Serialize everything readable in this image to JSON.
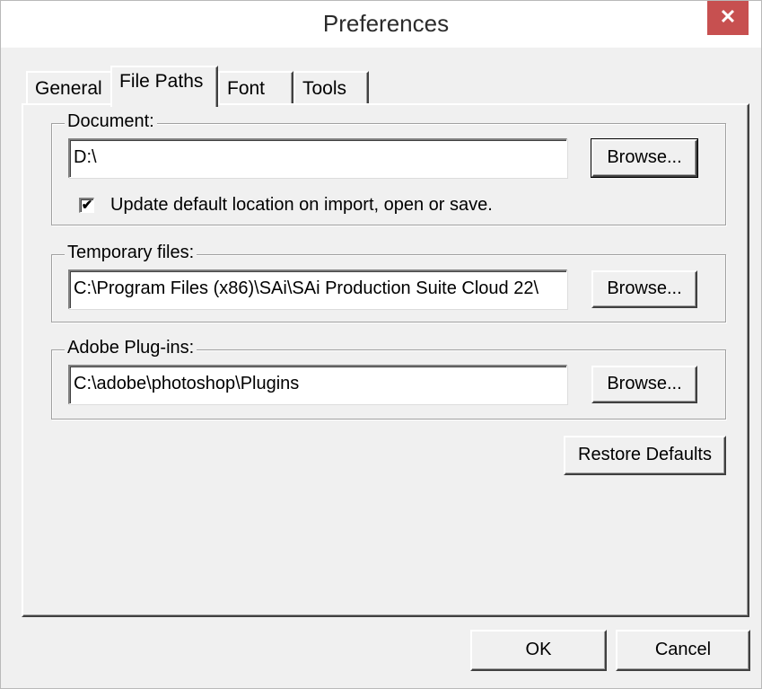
{
  "window": {
    "title": "Preferences",
    "close_glyph": "✕"
  },
  "tabs": [
    {
      "label": "General",
      "active": false
    },
    {
      "label": "File Paths",
      "active": true
    },
    {
      "label": "Font",
      "active": false
    },
    {
      "label": "Tools",
      "active": false
    }
  ],
  "document": {
    "label": "Document:",
    "value": "D:\\",
    "browse_label": "Browse...",
    "checkbox_checked": true,
    "checkbox_glyph": "✔",
    "checkbox_label": "Update default location on import, open or save."
  },
  "temporary": {
    "label": "Temporary files:",
    "value": "C:\\Program Files (x86)\\SAi\\SAi Production Suite Cloud 22\\",
    "browse_label": "Browse..."
  },
  "plugins": {
    "label": "Adobe Plug-ins:",
    "value": "C:\\adobe\\photoshop\\Plugins",
    "browse_label": "Browse..."
  },
  "restore_label": "Restore Defaults",
  "footer": {
    "ok_label": "OK",
    "cancel_label": "Cancel"
  },
  "colors": {
    "close_button": "#c75050",
    "dialog_background": "#f0f0f0"
  }
}
